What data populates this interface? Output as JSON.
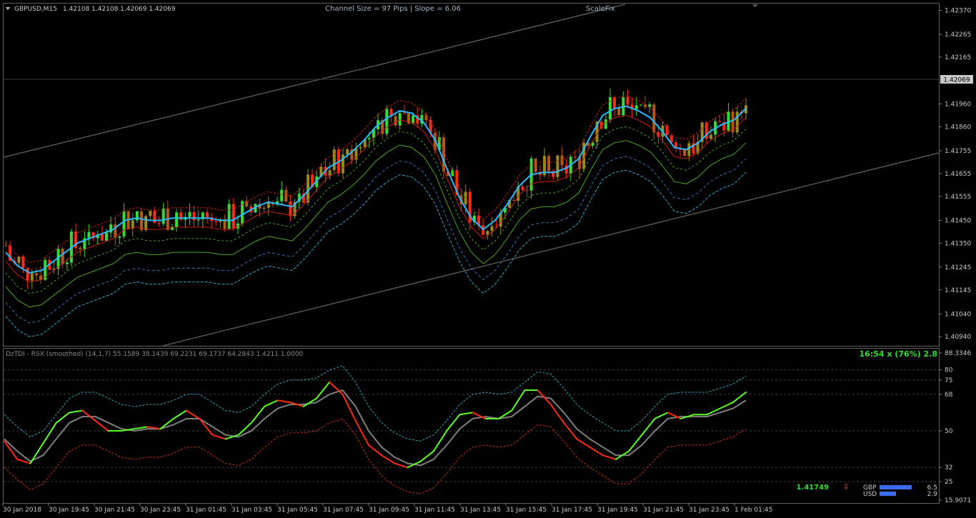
{
  "colors": {
    "background": "#000000",
    "frame": "#606060",
    "bull": "#32dc32",
    "bear": "#ff2a10",
    "ma_fast": "#2ab8ff",
    "channel": "#5a5a5a",
    "tdi_green": "#5aff28",
    "tdi_red": "#ff2a10",
    "signal": "#808080",
    "gbp_bar": "#3a6cf0",
    "usd_bar": "#3a6cf0"
  },
  "header": {
    "symbol": "GBPUSD,M15",
    "ohlc": "1.42108 1.42108 1.42069 1.42069",
    "channel_info": "Channel Size = 97 Pips  |  Slope = 6.06",
    "scalefix": "ScaleFix"
  },
  "indicator": {
    "title": "DzTDI - RSX (smoothed) (14,1,7) 55.1589 38.1439 69.2231 69.1737 64.2843 1.4211 1.0000",
    "timer": "16:54 x (76%) 2.8",
    "bid": "1.41749",
    "arrow": "⇩",
    "gbp_label": "GBP",
    "gbp_value": "6.5",
    "usd_label": "USD",
    "usd_value": "2.9"
  },
  "current_price": "1.42069",
  "chart_data": [
    {
      "type": "line",
      "title": "GBPUSD,M15",
      "y_axis_ticks": [
        "1.42370",
        "1.42265",
        "1.42165",
        "1.42069",
        "1.41960",
        "1.41860",
        "1.41755",
        "1.41655",
        "1.41555",
        "1.41450",
        "1.41350",
        "1.41245",
        "1.41145",
        "1.41040",
        "1.40940"
      ],
      "x_axis_ticks": [
        "30 Jan 2018",
        "30 Jan 19:45",
        "30 Jan 21:45",
        "30 Jan 23:45",
        "31 Jan 01:45",
        "31 Jan 03:45",
        "31 Jan 05:45",
        "31 Jan 07:45",
        "31 Jan 09:45",
        "31 Jan 11:45",
        "31 Jan 13:45",
        "31 Jan 15:45",
        "31 Jan 17:45",
        "31 Jan 19:45",
        "31 Jan 21:45",
        "31 Jan 23:45",
        "1 Feb 01:45"
      ],
      "ylim": [
        1.409,
        1.424
      ],
      "series": [
        {
          "values": [
            1.4131,
            1.4125,
            1.4122,
            1.4123,
            1.4127,
            1.4131,
            1.4135,
            1.4137,
            1.4139,
            1.4141,
            1.4145,
            1.4146,
            1.4145,
            1.4145,
            1.4146,
            1.4146,
            1.4146,
            1.4146,
            1.4145,
            1.4145,
            1.4148,
            1.4151,
            1.4153,
            1.4152,
            1.4151,
            1.4156,
            1.4162,
            1.4168,
            1.4171,
            1.4175,
            1.418,
            1.4186,
            1.419,
            1.4193,
            1.4192,
            1.4188,
            1.418,
            1.4167,
            1.4155,
            1.4146,
            1.4141,
            1.4145,
            1.4152,
            1.416,
            1.4165,
            1.4166,
            1.4166,
            1.4168,
            1.4172,
            1.4182,
            1.4191,
            1.4194,
            1.4195,
            1.4193,
            1.419,
            1.4184,
            1.4177,
            1.4176,
            1.4179,
            1.4184,
            1.4187,
            1.4189,
            1.4194
          ]
        }
      ]
    },
    {
      "type": "line",
      "title": "DzTDI - RSX (smoothed) (14,1,7) 55.1589 38.1439 69.2231 69.1737 64.2843 1.4211 1.0000",
      "y_axis_ticks": [
        "88.3346",
        "80",
        "75",
        "68",
        "50",
        "32",
        "25",
        "15.9071"
      ],
      "levels": [
        80,
        75,
        68,
        50,
        32,
        25
      ],
      "ylim": [
        15.9071,
        88.3346
      ],
      "series": [
        {
          "values": [
            45,
            36,
            34,
            44,
            54,
            59,
            60,
            55,
            50,
            50,
            51,
            52,
            51,
            56,
            60,
            56,
            48,
            46,
            48,
            54,
            62,
            65,
            64,
            62,
            66,
            74,
            68,
            55,
            43,
            38,
            34,
            32,
            35,
            40,
            50,
            58,
            59,
            56,
            56,
            60,
            70,
            70,
            63,
            54,
            46,
            42,
            38,
            36,
            40,
            48,
            56,
            59,
            56,
            58,
            58,
            61,
            64,
            69
          ]
        },
        {
          "values": [
            46,
            40,
            35,
            38,
            46,
            54,
            57,
            57,
            54,
            51,
            50,
            51,
            51,
            53,
            56,
            56,
            52,
            48,
            47,
            50,
            56,
            61,
            63,
            63,
            64,
            68,
            70,
            62,
            50,
            42,
            37,
            34,
            33,
            36,
            43,
            51,
            56,
            57,
            56,
            57,
            62,
            67,
            66,
            59,
            51,
            46,
            42,
            38,
            38,
            43,
            50,
            56,
            57,
            57,
            57,
            59,
            61,
            65
          ]
        }
      ]
    }
  ]
}
